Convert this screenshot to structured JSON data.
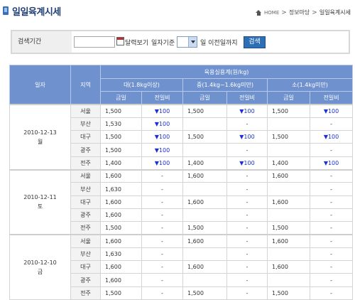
{
  "header": {
    "title": "일일육계시세",
    "breadcrumb": {
      "home": "HOME",
      "section": "정보마당",
      "current": "일일육계시세"
    },
    "separator": ">"
  },
  "search": {
    "period_label": "검색기간",
    "date_value": "",
    "calendar_label": "달력보기",
    "basis_label": "일자기준",
    "day_select_value": "",
    "day_suffix": "일 이전일까지",
    "button": "검색"
  },
  "table": {
    "col_date": "일자",
    "col_region": "지역",
    "col_group": "육용실용계(원/kg)",
    "sizes": [
      "대(1.8kg이상)",
      "중(1.4kg~1.6kg미만)",
      "소(1.4kg미만)"
    ],
    "sub_price": "금일",
    "sub_change": "전일비",
    "groups": [
      {
        "date": "2010-12-13",
        "weekday": "월",
        "rows": [
          {
            "region": "서울",
            "l_price": "1,500",
            "l_chg": "▼100",
            "m_price": "1,500",
            "m_chg": "▼100",
            "s_price": "1,500",
            "s_chg": "▼100"
          },
          {
            "region": "부산",
            "l_price": "1,530",
            "l_chg": "▼100",
            "m_price": "",
            "m_chg": "-",
            "s_price": "",
            "s_chg": "-"
          },
          {
            "region": "대구",
            "l_price": "1,500",
            "l_chg": "▼100",
            "m_price": "1,500",
            "m_chg": "▼100",
            "s_price": "1,500",
            "s_chg": "▼100"
          },
          {
            "region": "광주",
            "l_price": "1,500",
            "l_chg": "▼100",
            "m_price": "",
            "m_chg": "-",
            "s_price": "",
            "s_chg": "-"
          },
          {
            "region": "전주",
            "l_price": "1,400",
            "l_chg": "▼100",
            "m_price": "1,400",
            "m_chg": "▼100",
            "s_price": "1,400",
            "s_chg": "▼100"
          }
        ]
      },
      {
        "date": "2010-12-11",
        "weekday": "토",
        "rows": [
          {
            "region": "서울",
            "l_price": "1,600",
            "l_chg": "-",
            "m_price": "1,600",
            "m_chg": "-",
            "s_price": "1,600",
            "s_chg": "-"
          },
          {
            "region": "부산",
            "l_price": "1,630",
            "l_chg": "-",
            "m_price": "",
            "m_chg": "-",
            "s_price": "",
            "s_chg": "-"
          },
          {
            "region": "대구",
            "l_price": "1,600",
            "l_chg": "-",
            "m_price": "1,600",
            "m_chg": "-",
            "s_price": "1,600",
            "s_chg": "-"
          },
          {
            "region": "광주",
            "l_price": "1,600",
            "l_chg": "-",
            "m_price": "",
            "m_chg": "-",
            "s_price": "",
            "s_chg": "-"
          },
          {
            "region": "전주",
            "l_price": "1,500",
            "l_chg": "-",
            "m_price": "1,500",
            "m_chg": "-",
            "s_price": "1,500",
            "s_chg": "-"
          }
        ]
      },
      {
        "date": "2010-12-10",
        "weekday": "금",
        "rows": [
          {
            "region": "서울",
            "l_price": "1,600",
            "l_chg": "-",
            "m_price": "1,600",
            "m_chg": "-",
            "s_price": "1,600",
            "s_chg": "-"
          },
          {
            "region": "부산",
            "l_price": "1,630",
            "l_chg": "-",
            "m_price": "",
            "m_chg": "-",
            "s_price": "",
            "s_chg": "-"
          },
          {
            "region": "대구",
            "l_price": "1,600",
            "l_chg": "-",
            "m_price": "1,600",
            "m_chg": "-",
            "s_price": "1,600",
            "s_chg": "-"
          },
          {
            "region": "광주",
            "l_price": "1,600",
            "l_chg": "-",
            "m_price": "",
            "m_chg": "-",
            "s_price": "",
            "s_chg": "-"
          },
          {
            "region": "전주",
            "l_price": "1,500",
            "l_chg": "-",
            "m_price": "1,500",
            "m_chg": "-",
            "s_price": "1,500",
            "s_chg": "-"
          }
        ]
      }
    ]
  },
  "colors": {
    "title": "#1f3f73",
    "header_bg": "#6f92cf",
    "down_arrow": "#1a2fd6",
    "button": "#2d6fb4"
  }
}
